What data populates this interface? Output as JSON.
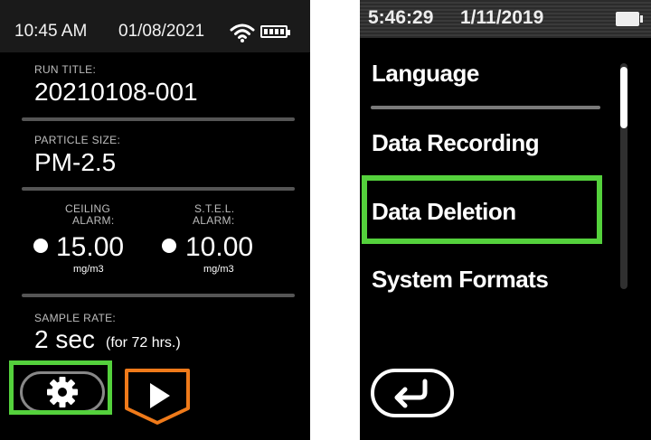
{
  "left_screen": {
    "status": {
      "time": "10:45 AM",
      "date": "01/08/2021",
      "icons": [
        "wifi-icon",
        "battery-icon"
      ]
    },
    "run_title": {
      "label": "RUN TITLE:",
      "value": "20210108-001"
    },
    "particle_size": {
      "label": "PARTICLE SIZE:",
      "value": "PM-2.5"
    },
    "ceiling_alarm": {
      "label_1": "CEILING",
      "label_2": "ALARM:",
      "value": "15.00",
      "unit": "mg/m3"
    },
    "stel_alarm": {
      "label_1": "S.T.E.L.",
      "label_2": "ALARM:",
      "value": "10.00",
      "unit": "mg/m3"
    },
    "sample_rate": {
      "label": "SAMPLE RATE:",
      "value": "2 sec",
      "note": "(for 72 hrs.)"
    },
    "buttons": {
      "settings_icon": "gear-icon",
      "start_icon": "play-icon"
    }
  },
  "right_screen": {
    "status": {
      "time": "5:46:29",
      "date": "1/11/2019",
      "icons": [
        "battery-icon"
      ]
    },
    "menu": [
      {
        "label": "Language"
      },
      {
        "label": "Data Recording"
      },
      {
        "label": "Data Deletion"
      },
      {
        "label": "System Formats"
      }
    ],
    "selected_item": "Data Deletion",
    "back_icon": "return-arrow-icon"
  },
  "colors": {
    "highlight": "#54d13c",
    "accent_orange": "#ef7a1a",
    "screen_bg": "#000000"
  }
}
